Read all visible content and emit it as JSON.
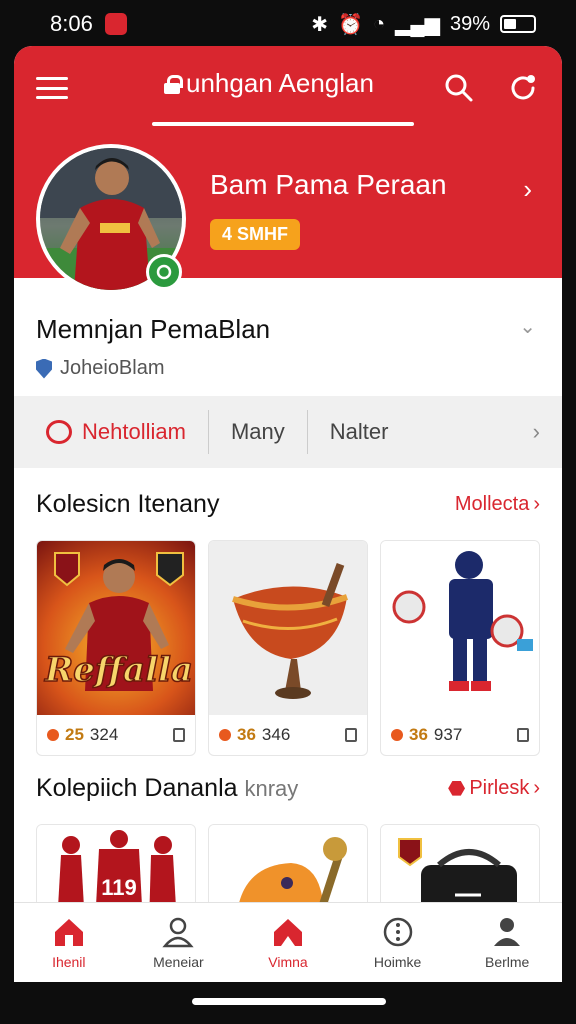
{
  "status_bar": {
    "time": "8:06",
    "battery": "39%"
  },
  "header": {
    "title": "unhgan Aenglan",
    "profile_name": "Bam Pama Peraan",
    "level_badge": "4 SMHF"
  },
  "player": {
    "title": "Memnjan PemaBlan",
    "subtitle": "JoheioBlam"
  },
  "tabs": [
    {
      "label": "Nehtolliam"
    },
    {
      "label": "Many"
    },
    {
      "label": "Nalter"
    }
  ],
  "collection1": {
    "title": "Kolesicn Itenany",
    "link": "Mollecta",
    "items": [
      {
        "price": "25",
        "code": "324",
        "image_text": "Reffalla"
      },
      {
        "price": "36",
        "code": "346"
      },
      {
        "price": "36",
        "code": "937"
      }
    ]
  },
  "collection2": {
    "title": "Kolepiich Dananla",
    "title_suffix": "knray",
    "link": "Pirlesk",
    "items": [
      {
        "image_text": "119"
      },
      {},
      {}
    ]
  },
  "bottom_nav": [
    {
      "label": "Ihenil"
    },
    {
      "label": "Meneiar"
    },
    {
      "label": "Vimna"
    },
    {
      "label": "Hoimke"
    },
    {
      "label": "Berlme"
    }
  ],
  "colors": {
    "brand_red": "#d9262f",
    "badge_orange": "#f6a21c",
    "price_gold": "#c27a12"
  }
}
